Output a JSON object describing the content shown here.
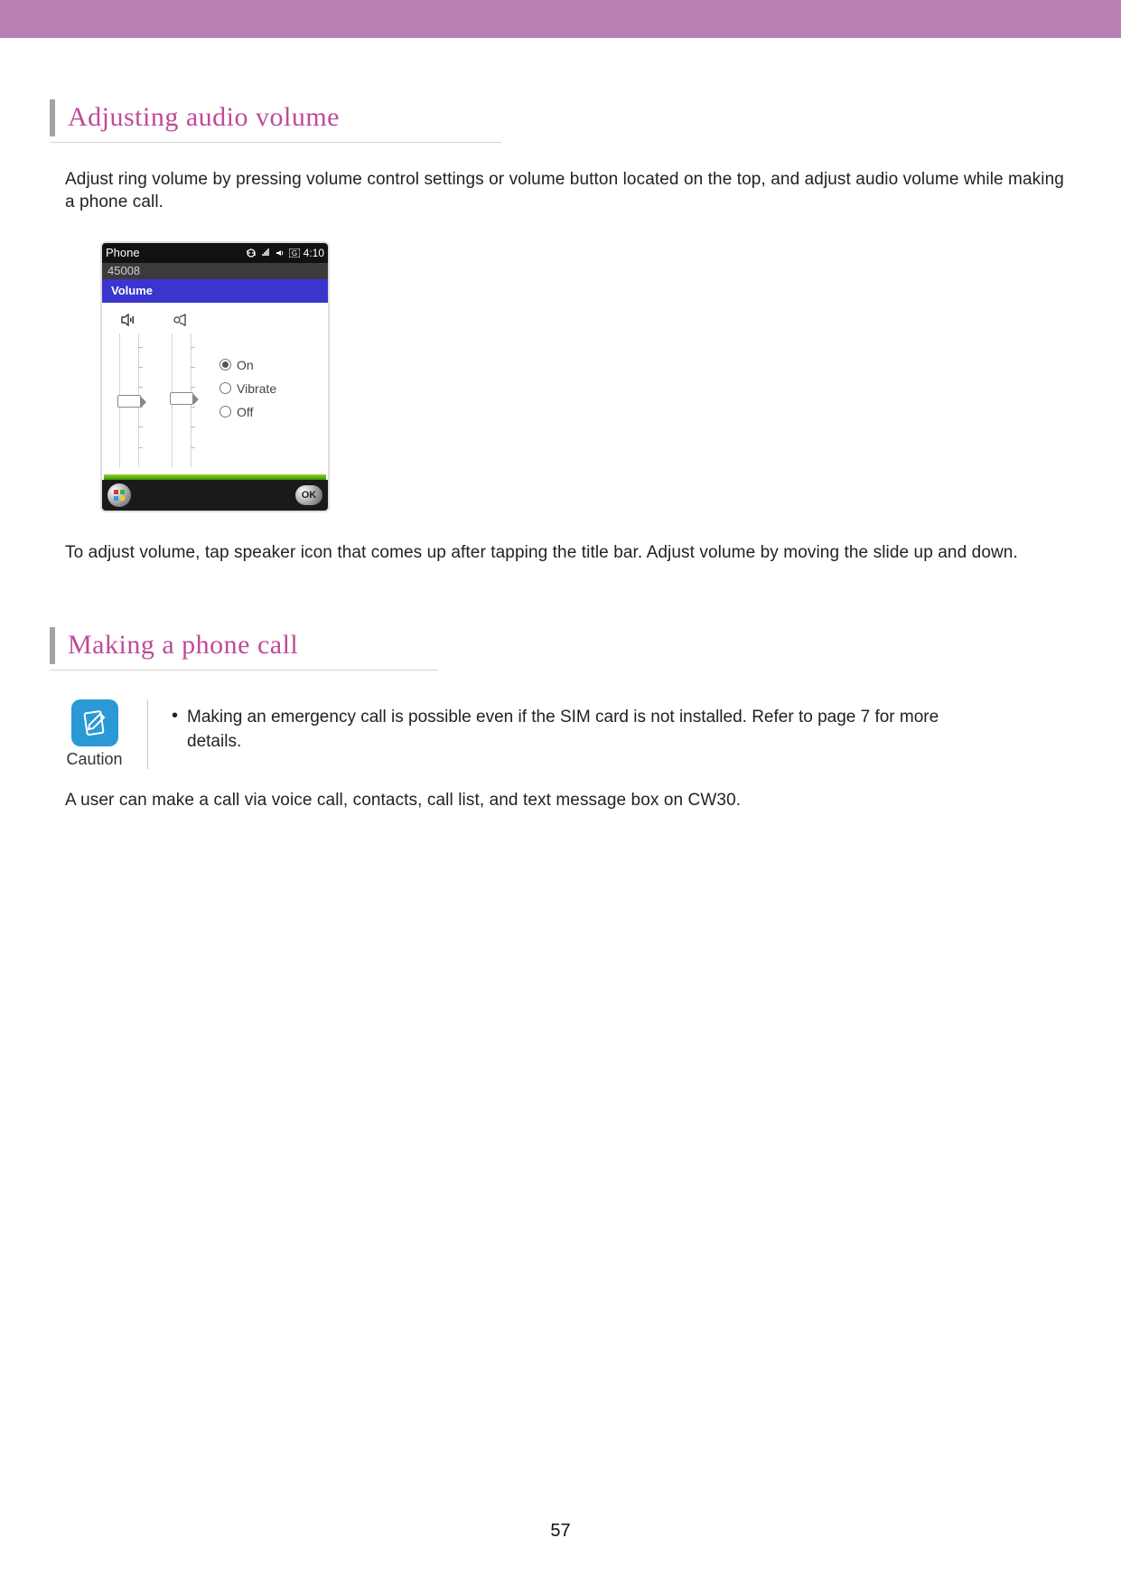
{
  "top_bar_color": "#b981b3",
  "section1": {
    "heading": "Adjusting audio volume",
    "para1": "Adjust ring volume by pressing volume control settings or volume button located on the top, and adjust audio volume while making a phone call.",
    "para2": "To adjust volume, tap speaker icon that comes up after tapping the title bar. Adjust volume by moving the slide up and down."
  },
  "phone": {
    "title": "Phone",
    "clock": "4:10",
    "number": "45008",
    "subtitle": "Volume",
    "radios": {
      "on": "On",
      "vibrate": "Vibrate",
      "off": "Off"
    },
    "ok": "OK"
  },
  "section2": {
    "heading": "Making a phone call",
    "caution_label": "Caution",
    "caution_text": "Making an emergency call is possible even if the SIM card is not installed. Refer to page 7 for more details.",
    "para": "A user can make a call via voice call, contacts, call list, and text message box on CW30."
  },
  "page_number": "57"
}
